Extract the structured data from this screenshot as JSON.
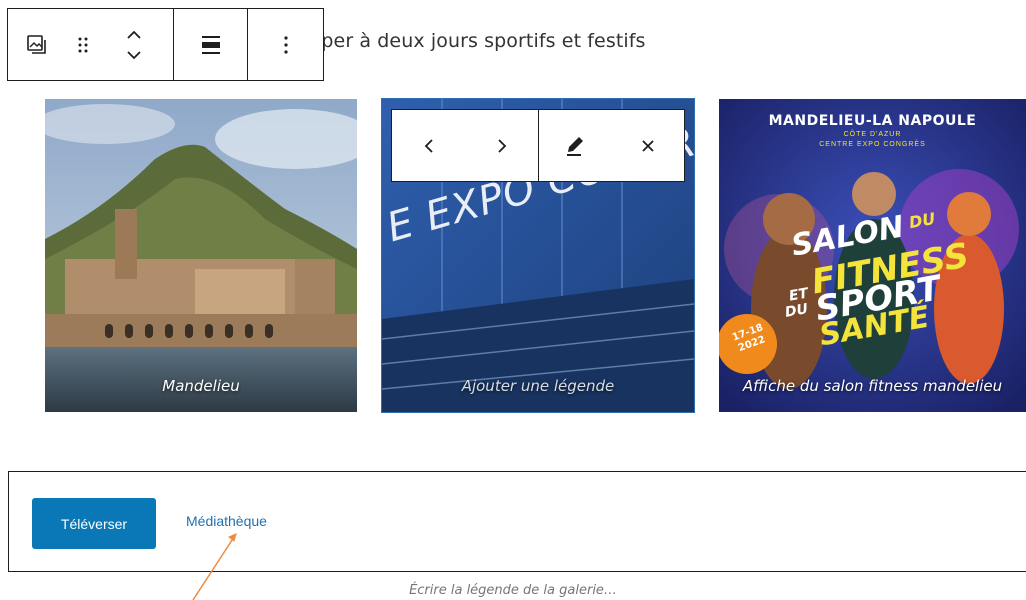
{
  "paragraph": {
    "text": "iper à deux jours sportifs et festifs"
  },
  "block_toolbar": {
    "icons": [
      "gallery-icon",
      "drag-handle-icon",
      "move-up-down-icon",
      "align-icon",
      "more-options-icon"
    ]
  },
  "gallery": {
    "images": [
      {
        "caption": "Mandelieu"
      },
      {
        "caption": "Ajouter une légende",
        "is_placeholder": true,
        "sign_text": "E EXPO CONGRE"
      },
      {
        "caption": "Affiche du salon fitness mandelieu",
        "poster_title": "MANDELIEU-LA NAPOULE",
        "poster_sub1": "CÔTE D'AZUR",
        "poster_sub2": "CENTRE EXPO CONGRÈS",
        "poster_words": [
          "SALON",
          "DU",
          "FITNESS",
          "ET",
          "DU",
          "SPORT",
          "SANTÉ"
        ],
        "poster_badge": [
          "17-18",
          "2022"
        ]
      }
    ]
  },
  "image_toolbar": {
    "icons": [
      "chevron-left-icon",
      "chevron-right-icon",
      "edit-pencil-icon",
      "close-icon"
    ]
  },
  "upload": {
    "upload_label": "Téléverser",
    "media_library_label": "Médiathèque"
  },
  "gallery_caption": {
    "placeholder": "Écrire la légende de la galerie…"
  },
  "colors": {
    "accent": "#0a77b6",
    "link": "#2271b1",
    "annotation_arrow": "#f08a3c",
    "selection_outline": "#2f6fb0"
  }
}
